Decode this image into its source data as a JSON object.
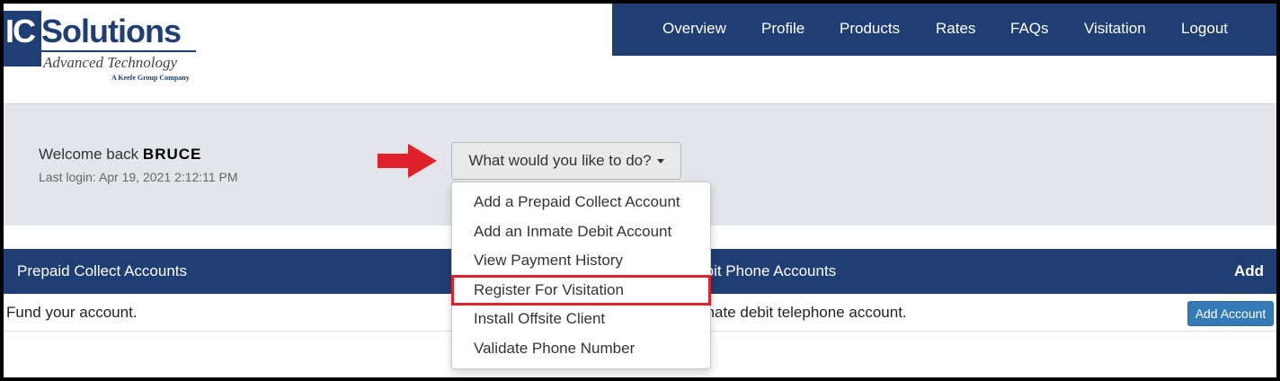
{
  "logo": {
    "ic": "IC",
    "solutions": "Solutions",
    "tagline": "Advanced Technology",
    "company": "A Keefe Group Company"
  },
  "nav": {
    "items": [
      "Overview",
      "Profile",
      "Products",
      "Rates",
      "FAQs",
      "Visitation",
      "Logout"
    ]
  },
  "welcome": {
    "greeting": "Welcome back",
    "user": "BRUCE",
    "last_login": "Last login: Apr 19, 2021 2:12:11 PM"
  },
  "dropdown": {
    "label": "What would you like to do?",
    "items": [
      "Add a Prepaid Collect Account",
      "Add an Inmate Debit Account",
      "View Payment History",
      "Register For Visitation",
      "Install Offsite Client",
      "Validate Phone Number"
    ],
    "highlighted_item": "Register For Visitation"
  },
  "tables": {
    "left_header": "Prepaid Collect Accounts",
    "right_header": "te Debit Phone Accounts",
    "add_header": "Add",
    "left_cell": "Fund your account.",
    "right_cell": "an inmate debit telephone account.",
    "add_button": "Add Account"
  },
  "colors": {
    "brand_navy": "#1f3e74",
    "highlight_red": "#e0202a",
    "button_blue": "#337ab7"
  }
}
